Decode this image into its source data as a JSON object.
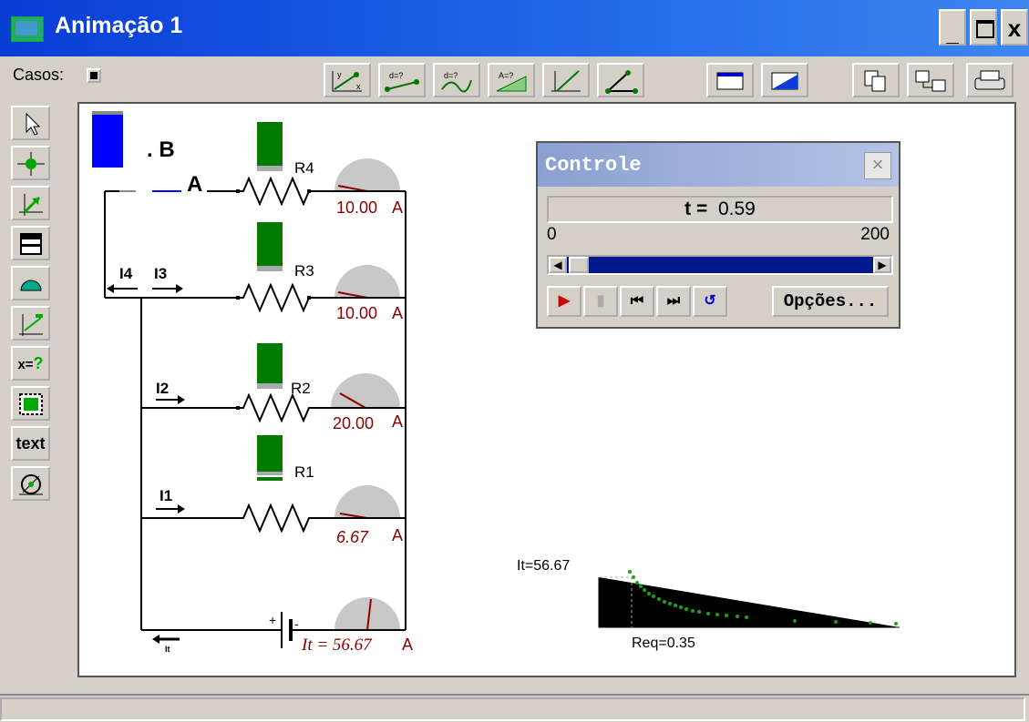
{
  "window": {
    "title": "Animação 1",
    "min": "_",
    "close": "x"
  },
  "toolbar": {
    "casos_label": "Casos:"
  },
  "tools": {
    "text_label": "text",
    "x_label": "x="
  },
  "circuit": {
    "label_b": ". B",
    "label_a": "A",
    "resistors": [
      "R4",
      "R3",
      "R2",
      "R1"
    ],
    "readings": [
      "10.00",
      "10.00",
      "20.00",
      "6.67"
    ],
    "unit": "A",
    "currents": [
      "I4",
      "I3",
      "I2",
      "I1"
    ],
    "battery_plus": "+",
    "battery_minus": "-",
    "total_label": "It = 56.67",
    "total_unit": "A"
  },
  "controle": {
    "title": "Controle",
    "close": "×",
    "t_label": "t =",
    "t_value": "0.59",
    "range_min": "0",
    "range_max": "200",
    "options_label": "Opções..."
  },
  "graph": {
    "y_label": "It=56.67",
    "x_label": "Req=0.35"
  },
  "colors": {
    "title_blue": "#0a3cd6",
    "resistor_green": "#007a00",
    "reading_red": "#8b0000",
    "plot_green": "#19a319"
  }
}
